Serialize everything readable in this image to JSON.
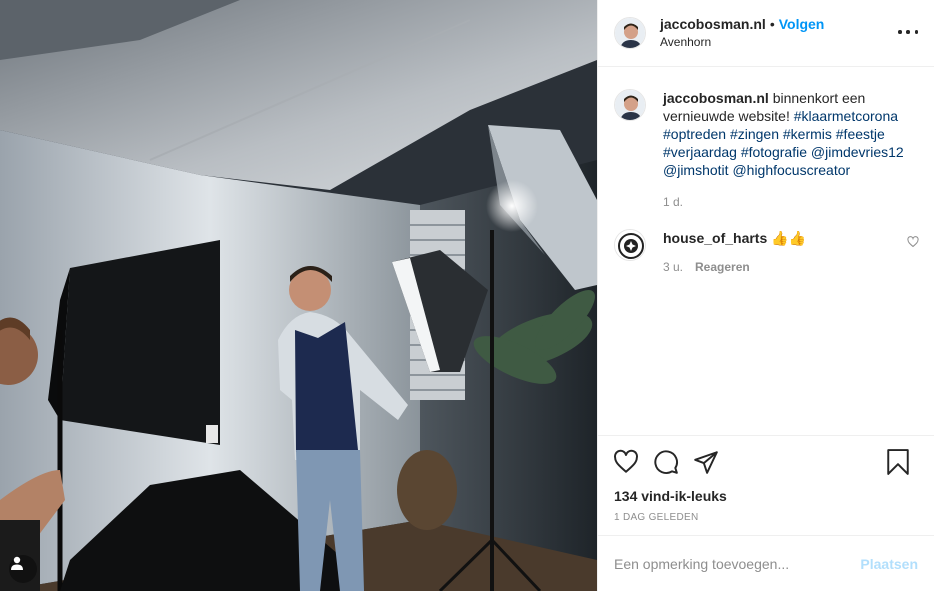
{
  "post": {
    "author": "jaccobosman.nl",
    "follow_label": "Volgen",
    "separator": "•",
    "location": "Avenhorn",
    "caption": {
      "author": "jaccobosman.nl",
      "text": " binnenkort een vernieuwde website! ",
      "hashtags": "#klaarmetcorona #optreden #zingen #kermis #feestje #verjaardag #fotografie",
      "mentions": " @jimdevries12 @jimshotit @highfocuscreator",
      "age": "1 d."
    },
    "comments": [
      {
        "author": "house_of_harts",
        "text": "👍👍",
        "age": "3 u.",
        "reply_label": "Reageren"
      }
    ],
    "likes": "134 vind-ik-leuks",
    "date": "1 DAG GELEDEN",
    "comment_input_placeholder": "Een opmerking toevoegen...",
    "post_button_label": "Plaatsen"
  },
  "colors": {
    "link_blue": "#0095f6",
    "disabled_blue": "#b2dffc",
    "secondary_text": "#8e8e8e"
  },
  "icons": [
    "user-tag-icon",
    "more-options-icon",
    "heart-icon",
    "comment-icon",
    "share-icon",
    "bookmark-icon",
    "small-heart-icon"
  ]
}
